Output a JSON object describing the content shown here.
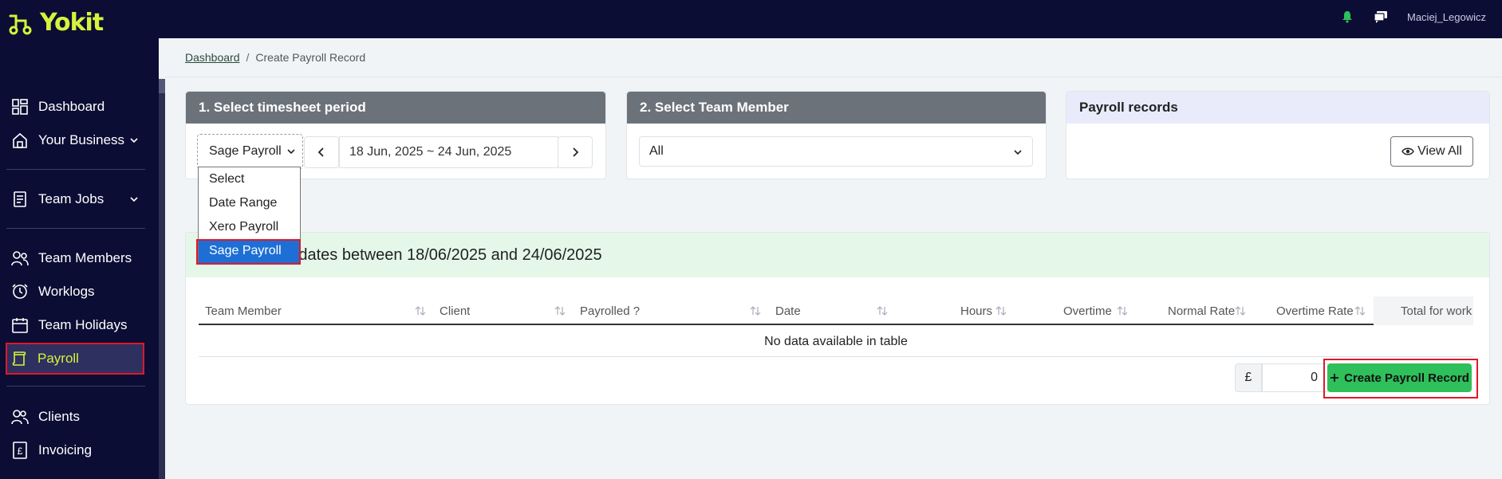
{
  "app": {
    "logo_text": "Yokit",
    "username": "Maciej_Legowicz"
  },
  "colors": {
    "brand": "#d6f23c",
    "sidebar": "#0b0d34",
    "success": "#2fbf5b",
    "highlight": "#e0182a",
    "selection": "#1d6fd6"
  },
  "sidebar": {
    "items": [
      {
        "label": "Dashboard",
        "icon": "dashboard-icon"
      },
      {
        "label": "Your Business",
        "icon": "home-icon"
      },
      {
        "label": "Team Jobs",
        "icon": "jobs-icon"
      },
      {
        "label": "Team Members",
        "icon": "team-members-icon"
      },
      {
        "label": "Worklogs",
        "icon": "clock-icon"
      },
      {
        "label": "Team Holidays",
        "icon": "calendar-icon"
      },
      {
        "label": "Payroll",
        "icon": "payroll-icon"
      },
      {
        "label": "Clients",
        "icon": "clients-icon"
      },
      {
        "label": "Invoicing",
        "icon": "pound-icon"
      }
    ]
  },
  "breadcrumb": {
    "home": "Dashboard",
    "separator": "/",
    "current": "Create Payroll Record"
  },
  "period_card": {
    "title": "1. Select timesheet period",
    "selected": "Sage Payroll",
    "date_range": "18 Jun, 2025 ~ 24 Jun, 2025",
    "options": [
      "Select",
      "Date Range",
      "Xero Payroll",
      "Sage Payroll"
    ]
  },
  "member_card": {
    "title": "2. Select Team Member",
    "selected": "All"
  },
  "records_card": {
    "title": "Payroll records",
    "view_all": "View All"
  },
  "results": {
    "heading": "Timesheets for dates between 18/06/2025 and 24/06/2025",
    "visible_heading": "or dates between 18/06/2025 and 24/06/2025",
    "columns": [
      "Team Member",
      "Client",
      "Payrolled ?",
      "Date",
      "Hours",
      "Overtime",
      "Normal Rate",
      "Overtime Rate",
      "Total for work"
    ],
    "empty_message": "No data available in table",
    "currency": "£",
    "amount": "0",
    "create_label": "Create Payroll Record"
  }
}
